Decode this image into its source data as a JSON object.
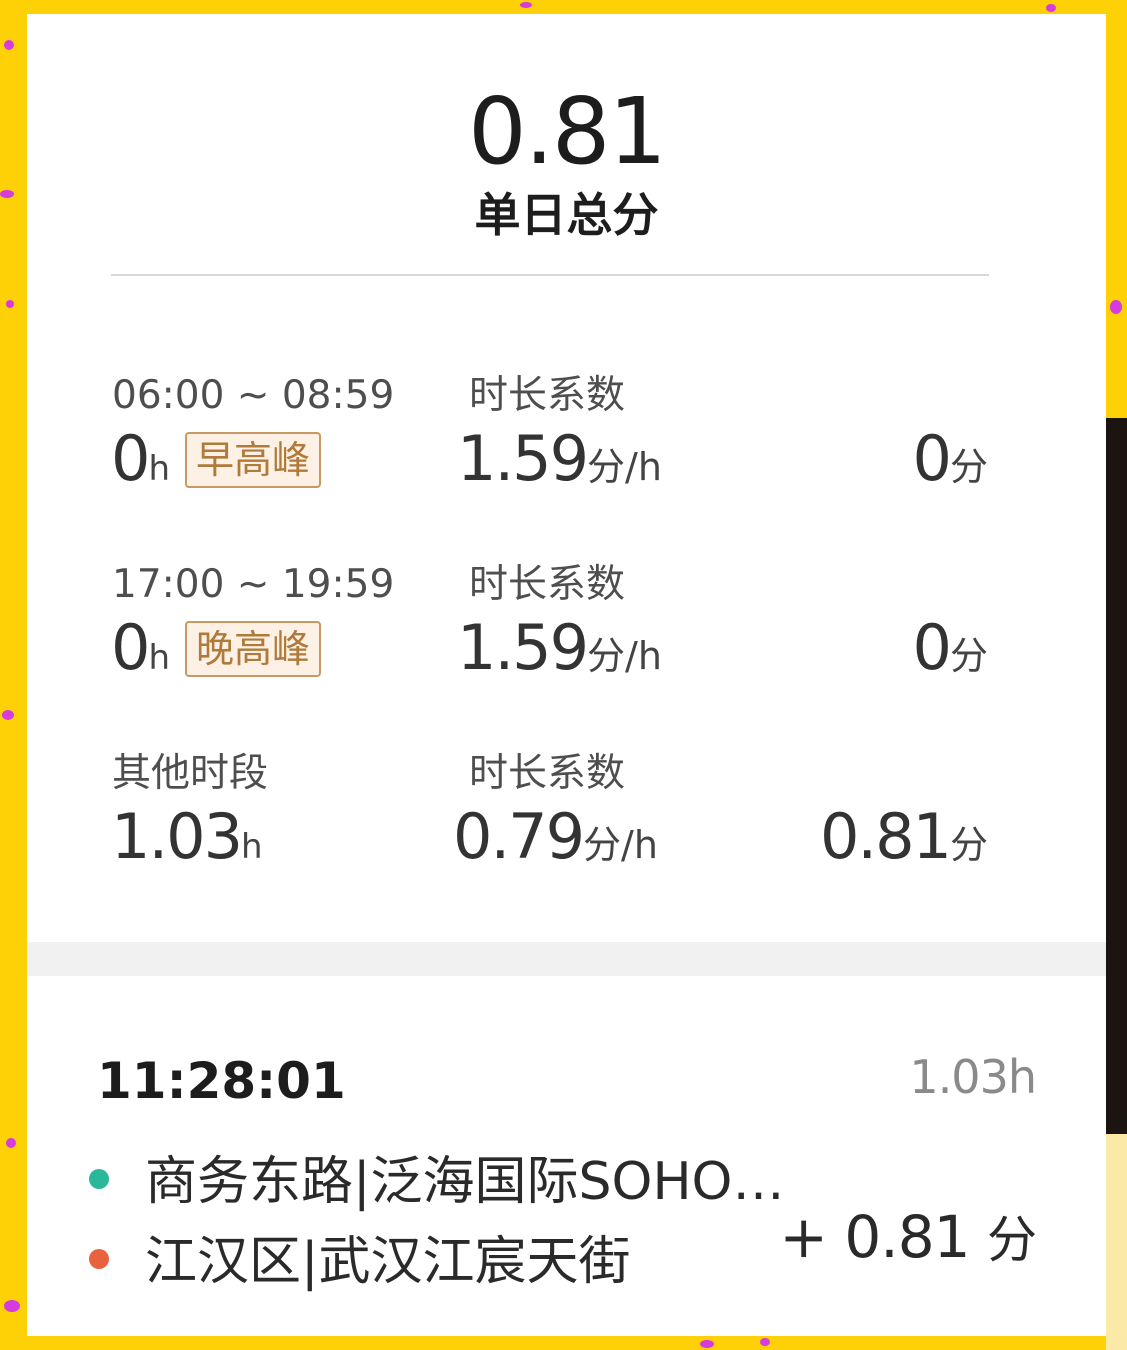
{
  "summary": {
    "total_score": "0.81",
    "total_label": "单日总分"
  },
  "periods": [
    {
      "time_range": "06:00 ~ 08:59",
      "hours": "0",
      "hours_unit": "h",
      "badge": "早高峰",
      "coef_label": "时长系数",
      "coef_value": "1.59",
      "coef_unit": "分/h",
      "points": "0",
      "points_unit": "分"
    },
    {
      "time_range": "17:00 ~ 19:59",
      "hours": "0",
      "hours_unit": "h",
      "badge": "晚高峰",
      "coef_label": "时长系数",
      "coef_value": "1.59",
      "coef_unit": "分/h",
      "points": "0",
      "points_unit": "分"
    },
    {
      "time_range": "其他时段",
      "hours": "1.03",
      "hours_unit": "h",
      "coef_label": "时长系数",
      "coef_value": "0.79",
      "coef_unit": "分/h",
      "points": "0.81",
      "points_unit": "分"
    }
  ],
  "trip": {
    "time": "11:28:01",
    "duration": "1.03h",
    "start": "商务东路|泛海国际SOHO…",
    "end": "江汉区|武汉江宸天街",
    "points": "+ 0.81",
    "points_unit": "分"
  },
  "colors": {
    "frame": "#FDD106",
    "badge_border": "#C69A62",
    "badge_text": "#B07A3A",
    "start_bullet": "#2BB89A",
    "end_bullet": "#E8623E"
  }
}
